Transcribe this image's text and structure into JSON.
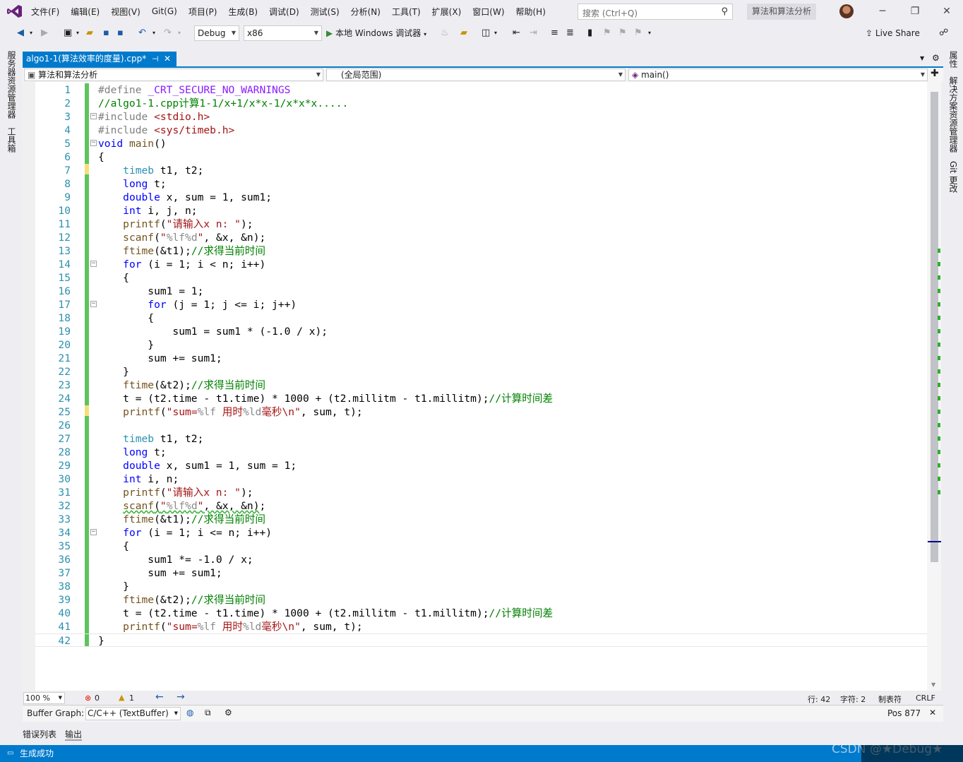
{
  "menu": [
    "文件(F)",
    "编辑(E)",
    "视图(V)",
    "Git(G)",
    "项目(P)",
    "生成(B)",
    "调试(D)",
    "测试(S)",
    "分析(N)",
    "工具(T)",
    "扩展(X)",
    "窗口(W)",
    "帮助(H)"
  ],
  "search": {
    "placeholder": "搜索 (Ctrl+Q)"
  },
  "solution_name": "算法和算法分析",
  "toolbar": {
    "config": "Debug",
    "platform": "x86",
    "run_label": "本地 Windows 调试器",
    "live_share": "Live Share"
  },
  "side_left": [
    "服务器资源管理器",
    "工具箱"
  ],
  "side_right": [
    "属性",
    "解决方案资源管理器",
    "Git 更改"
  ],
  "tab": {
    "title": "algo1-1(算法效率的度量).cpp*",
    "pin": "⊣",
    "close": "✕"
  },
  "navbar": {
    "project": "算法和算法分析",
    "scope": "(全局范围)",
    "member": "main()"
  },
  "editor": {
    "lines": [
      {
        "n": "1",
        "html": "<span class=\"pp\">#define</span> <span class=\"fn\" style=\"color:#8a1bff\">_CRT_SECURE_NO_WARNINGS</span>"
      },
      {
        "n": "2",
        "html": "<span class=\"cm\">//algo1-1.cpp计算1-1/x+1/x*x-1/x*x*x.....</span>"
      },
      {
        "n": "3",
        "html": "<span class=\"pp\">#include</span> <span class=\"st\">&lt;stdio.h&gt;</span>",
        "fold": "−"
      },
      {
        "n": "4",
        "html": "<span class=\"pp\">#include</span> <span class=\"st\">&lt;sys/timeb.h&gt;</span>"
      },
      {
        "n": "5",
        "html": "<span class=\"kw\">void</span> <span class=\"fn\">main</span>()",
        "fold": "−"
      },
      {
        "n": "6",
        "html": "{"
      },
      {
        "n": "7",
        "html": "    <span class=\"ty\">timeb</span> t1, t2;"
      },
      {
        "n": "8",
        "html": "    <span class=\"kw\">long</span> t;"
      },
      {
        "n": "9",
        "html": "    <span class=\"kw\">double</span> x, sum = 1, sum1;"
      },
      {
        "n": "10",
        "html": "    <span class=\"kw\">int</span> i, j, n;"
      },
      {
        "n": "11",
        "html": "    <span class=\"fn\">printf</span>(<span class=\"st\">\"请输入x n: \"</span>);"
      },
      {
        "n": "12",
        "html": "    <span class=\"fn\">scanf</span>(<span class=\"st\">\"<span class=\"fmt\">%lf%d</span>\"</span>, &amp;x, &amp;n);"
      },
      {
        "n": "13",
        "html": "    <span class=\"fn\">ftime</span>(&amp;t1);<span class=\"cm\">//求得当前时间</span>"
      },
      {
        "n": "14",
        "html": "    <span class=\"kw\">for</span> (i = 1; i &lt; n; i++)",
        "fold": "−"
      },
      {
        "n": "15",
        "html": "    {"
      },
      {
        "n": "16",
        "html": "        sum1 = 1;"
      },
      {
        "n": "17",
        "html": "        <span class=\"kw\">for</span> (j = 1; j &lt;= i; j++)",
        "fold": "−"
      },
      {
        "n": "18",
        "html": "        {"
      },
      {
        "n": "19",
        "html": "            sum1 = sum1 * (-1.0 / x);"
      },
      {
        "n": "20",
        "html": "        }"
      },
      {
        "n": "21",
        "html": "        sum += sum1;"
      },
      {
        "n": "22",
        "html": "    }"
      },
      {
        "n": "23",
        "html": "    <span class=\"fn\">ftime</span>(&amp;t2);<span class=\"cm\">//求得当前时间</span>"
      },
      {
        "n": "24",
        "html": "    t = (t2.time - t1.time) * 1000 + (t2.millitm - t1.millitm);<span class=\"cm\">//计算时间差</span>"
      },
      {
        "n": "25",
        "html": "    <span class=\"fn\">printf</span>(<span class=\"st\">\"sum=<span class=\"fmt\">%lf</span> 用时<span class=\"fmt\">%ld</span>毫秒\\n\"</span>, sum, t);"
      },
      {
        "n": "26",
        "html": ""
      },
      {
        "n": "27",
        "html": "    <span class=\"ty\">timeb</span> t1, t2;"
      },
      {
        "n": "28",
        "html": "    <span class=\"kw\">long</span> t;"
      },
      {
        "n": "29",
        "html": "    <span class=\"kw\">double</span> x, sum1 = 1, sum = 1;"
      },
      {
        "n": "30",
        "html": "    <span class=\"kw\">int</span> i, n;"
      },
      {
        "n": "31",
        "html": "    <span class=\"fn\">printf</span>(<span class=\"st\">\"请输入x n: \"</span>);"
      },
      {
        "n": "32",
        "html": "    <span class=\"fn\" style=\"text-decoration:underline wavy #2cb02c\">scanf</span><span style=\"text-decoration:underline wavy #2cb02c\">(<span class=\"st\">\"<span class=\"fmt\">%lf%d</span>\"</span>, &amp;x, &amp;n)</span>;"
      },
      {
        "n": "33",
        "html": "    <span class=\"fn\">ftime</span>(&amp;t1);<span class=\"cm\">//求得当前时间</span>"
      },
      {
        "n": "34",
        "html": "    <span class=\"kw\">for</span> (i = 1; i &lt;= n; i++)",
        "fold": "−"
      },
      {
        "n": "35",
        "html": "    {"
      },
      {
        "n": "36",
        "html": "        sum1 *= -1.0 / x;"
      },
      {
        "n": "37",
        "html": "        sum += sum1;"
      },
      {
        "n": "38",
        "html": "    }"
      },
      {
        "n": "39",
        "html": "    <span class=\"fn\">ftime</span>(&amp;t2);<span class=\"cm\">//求得当前时间</span>"
      },
      {
        "n": "40",
        "html": "    t = (t2.time - t1.time) * 1000 + (t2.millitm - t1.millitm);<span class=\"cm\">//计算时间差</span>"
      },
      {
        "n": "41",
        "html": "    <span class=\"fn\">printf</span>(<span class=\"st\">\"sum=<span class=\"fmt\">%lf</span> 用时<span class=\"fmt\">%ld</span>毫秒\\n\"</span>, sum, t);"
      },
      {
        "n": "42",
        "html": "}"
      }
    ]
  },
  "edstatus": {
    "zoom": "100 %",
    "errors": "0",
    "warnings": "1",
    "line": "行: 42",
    "col": "字符: 2",
    "tabs": "制表符",
    "eol": "CRLF"
  },
  "bufgraph": {
    "label": "Buffer Graph:",
    "value": "C/C++ (TextBuffer)",
    "pos": "Pos 877"
  },
  "bottom_tabs": [
    "错误列表",
    "输出"
  ],
  "status": {
    "message": "生成成功",
    "watermark": "CSDN @★Debug★"
  },
  "colors": {
    "accent": "#007acc",
    "change_bar": "#5ec45e",
    "keyword": "#0000ff",
    "comment": "#008000",
    "string": "#a31515",
    "type": "#2b91af"
  }
}
